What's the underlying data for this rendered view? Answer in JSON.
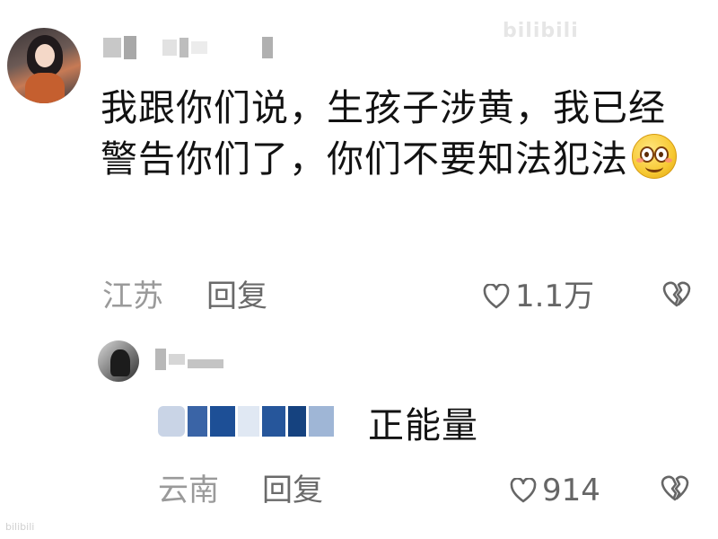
{
  "watermark": {
    "top": "bilibili",
    "bottom": "bilibili"
  },
  "comment": {
    "text": "我跟你们说，生孩子涉黄，我已经警告你们了，你们不要知法犯法",
    "emoji_icon": "smiling-blushing-emoji-icon",
    "location": "江苏",
    "reply_label": "回复",
    "likes": "1.1万"
  },
  "reply": {
    "text": "正能量",
    "location": "云南",
    "reply_label": "回复",
    "likes": "914"
  },
  "icons": {
    "heart": "heart-outline-icon",
    "dislike": "broken-heart-icon"
  },
  "colors": {
    "text": "#121212",
    "meta": "#9a9a9a",
    "mention": "#1d4f96"
  }
}
